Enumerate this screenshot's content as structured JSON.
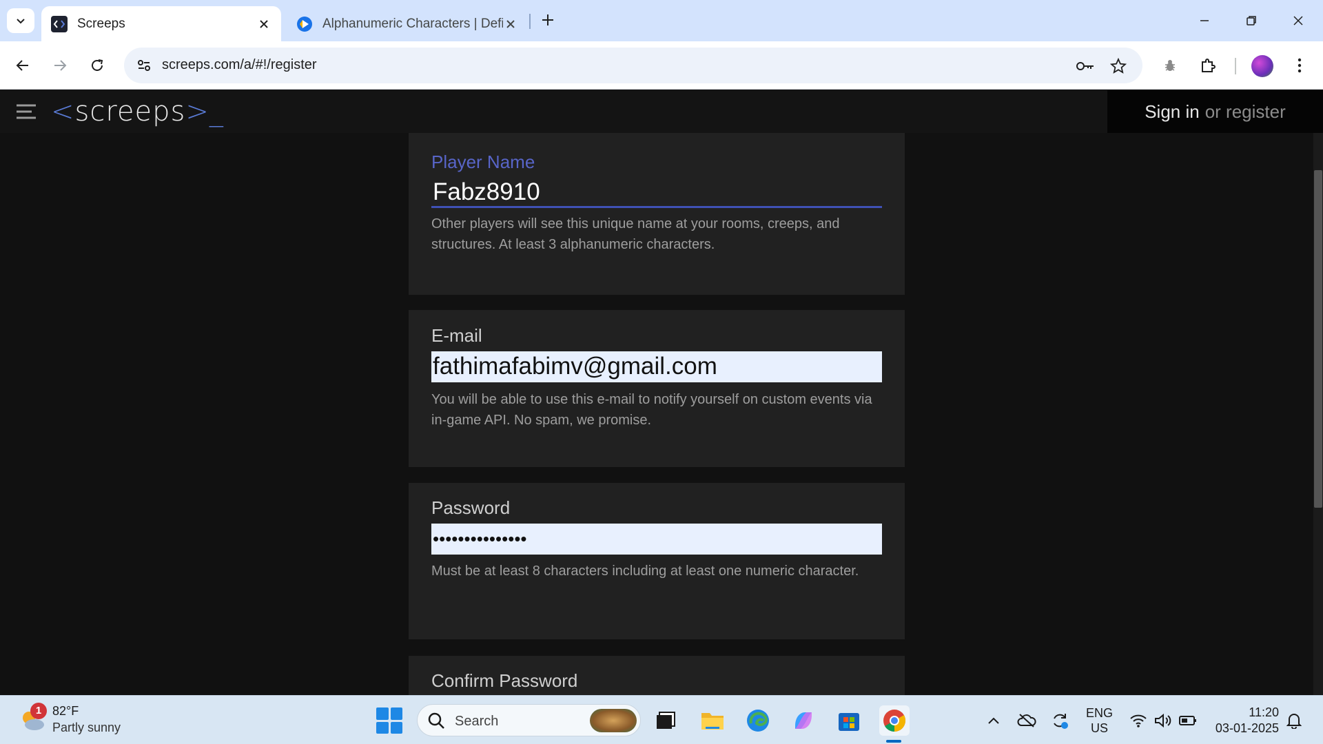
{
  "browser": {
    "tabs": [
      {
        "title": "Screeps",
        "active": true
      },
      {
        "title": "Alphanumeric Characters | Defi",
        "active": false
      }
    ],
    "url": "screeps.com/a/#!/register"
  },
  "site": {
    "logo": {
      "open": "<",
      "name": "screeps",
      "close": ">_"
    },
    "sign_in": "Sign in",
    "or_register": "or register"
  },
  "form": {
    "player_name": {
      "label": "Player Name",
      "value": "Fabz8910",
      "hint": "Other players will see this unique name at your rooms, creeps, and structures. At least 3 alphanumeric characters."
    },
    "email": {
      "label": "E-mail",
      "value": "fathimafabimv@gmail.com",
      "hint": "You will be able to use this e-mail to notify yourself on custom events via in-game API. No spam, we promise."
    },
    "password": {
      "label": "Password",
      "value": "•••••••••••••••",
      "hint": "Must be at least 8 characters including at least one numeric character."
    },
    "confirm_password": {
      "label": "Confirm Password"
    }
  },
  "taskbar": {
    "weather": {
      "temp": "82°F",
      "desc": "Partly sunny",
      "badge": "1"
    },
    "search_placeholder": "Search",
    "lang_line1": "ENG",
    "lang_line2": "US",
    "time": "11:20",
    "date": "03-01-2025"
  },
  "colors": {
    "accent": "#3f51b5",
    "focused_label": "#5865c8",
    "card_bg": "#212121",
    "page_bg": "#111111"
  }
}
